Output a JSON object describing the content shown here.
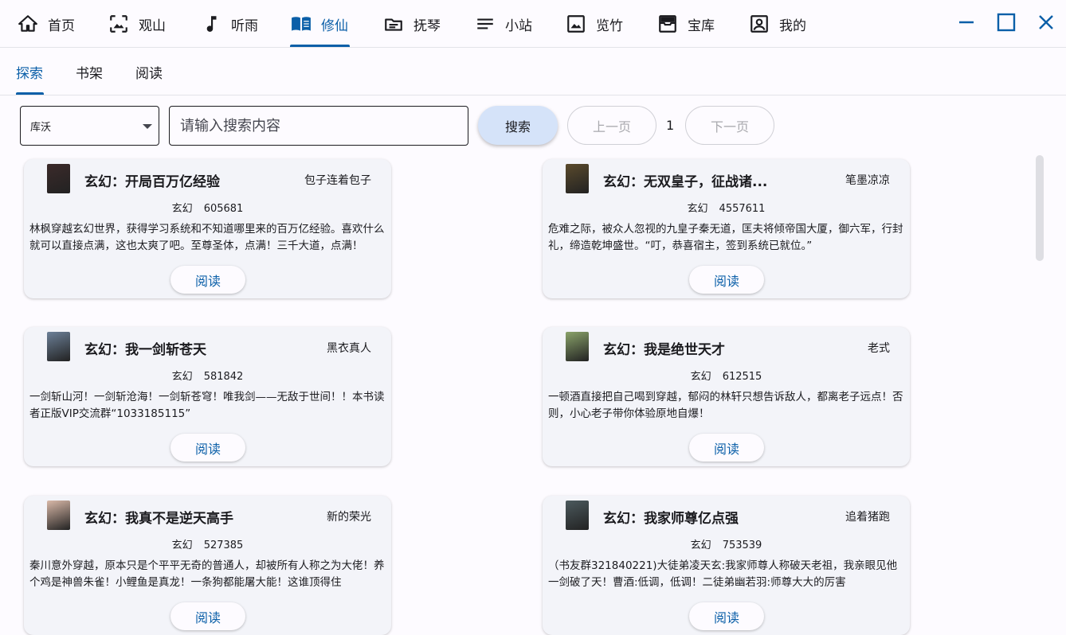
{
  "nav": {
    "items": [
      {
        "label": "首页",
        "icon": "home-icon"
      },
      {
        "label": "观山",
        "icon": "landscape-icon"
      },
      {
        "label": "听雨",
        "icon": "music-note-icon"
      },
      {
        "label": "修仙",
        "icon": "book-open-icon"
      },
      {
        "label": "抚琴",
        "icon": "article-icon"
      },
      {
        "label": "小站",
        "icon": "list-icon"
      },
      {
        "label": "览竹",
        "icon": "image-icon"
      },
      {
        "label": "宝库",
        "icon": "inbox-icon"
      },
      {
        "label": "我的",
        "icon": "account-box-icon"
      }
    ],
    "active": "修仙",
    "accent_color": "#0b5fa8"
  },
  "window": {
    "minimize_icon": "minimize-icon",
    "maximize_icon": "maximize-icon",
    "close_icon": "close-icon",
    "control_color": "#0b5fa8"
  },
  "subtabs": {
    "items": [
      "探索",
      "书架",
      "阅读"
    ],
    "active": "探索"
  },
  "search": {
    "source": "库沃",
    "placeholder": "请输入搜索内容",
    "value": "",
    "search_label": "搜索",
    "prev_label": "上一页",
    "page": "1",
    "next_label": "下一页"
  },
  "books": [
    {
      "title": "玄幻：开局百万亿经验",
      "author": "包子连着包子",
      "kind": "玄幻",
      "count": "605681",
      "intro": "林枫穿越玄幻世界，获得学习系统和不知道哪里来的百万亿经验。喜欢什么就可以直接点满，这也太爽了吧。至尊圣体，点满！三千大道，点满！",
      "read_label": "阅读",
      "cover_color": "#3b2a2a"
    },
    {
      "title": "玄幻：无双皇子，征战诸...",
      "author": "笔墨凉凉",
      "kind": "玄幻",
      "count": "4557611",
      "intro": "危难之际，被众人忽视的九皇子秦无道，匡夫将倾帝国大厦，御六军，行封礼，缔造乾坤盛世。“叮，恭喜宿主，签到系统已就位。”",
      "read_label": "阅读",
      "cover_color": "#5a4a2c"
    },
    {
      "title": "玄幻：我一剑斩苍天",
      "author": "黑衣真人",
      "kind": "玄幻",
      "count": "581842",
      "intro": "一剑斩山河！一剑斩沧海！一剑斩苍穹！唯我剑——无敌于世间！！本书读者正版VIP交流群“1033185115”",
      "read_label": "阅读",
      "cover_color": "#6c8098"
    },
    {
      "title": "玄幻：我是绝世天才",
      "author": "老式",
      "kind": "玄幻",
      "count": "612515",
      "intro": "一顿酒直接把自己喝到穿越，郁闷的林轩只想告诉敌人，都离老子远点！否则，小心老子带你体验原地自爆！",
      "read_label": "阅读",
      "cover_color": "#8aa36a"
    },
    {
      "title": "玄幻：我真不是逆天高手",
      "author": "新的荣光",
      "kind": "玄幻",
      "count": "527385",
      "intro": "秦川意外穿越，原本只是个平平无奇的普通人，却被所有人称之为大佬！养个鸡是神兽朱雀！小鲤鱼是真龙！一条狗都能屠大能！这谁顶得住",
      "read_label": "阅读",
      "cover_color": "#d9b9a8"
    },
    {
      "title": "玄幻：我家师尊亿点强",
      "author": "追着猪跑",
      "kind": "玄幻",
      "count": "753539",
      "intro": "（书友群321840221)大徒弟凌天玄:我家师尊人称破天老祖，我亲眼见他一剑破了天！曹酒:低调，低调！二徒弟幽若羽:师尊大大的厉害",
      "read_label": "阅读",
      "cover_color": "#4c5a5e"
    }
  ]
}
